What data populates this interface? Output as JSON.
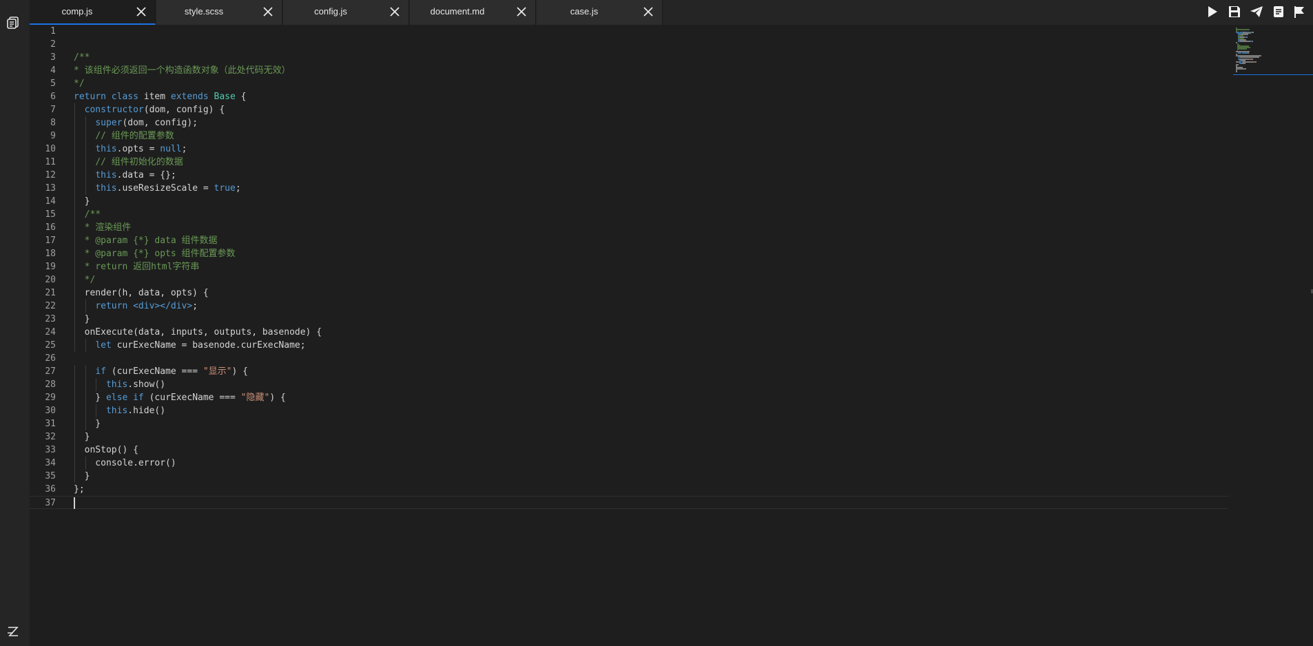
{
  "tabs": [
    {
      "label": "comp.js",
      "active": true
    },
    {
      "label": "style.scss",
      "active": false
    },
    {
      "label": "config.js",
      "active": false
    },
    {
      "label": "document.md",
      "active": false
    },
    {
      "label": "case.js",
      "active": false
    }
  ],
  "toolbar": [
    "run-icon",
    "save-icon",
    "send-icon",
    "document-icon",
    "flag-icon"
  ],
  "activity": {
    "top_icon": "files-icon",
    "bottom_icon": "logo-icon"
  },
  "colors": {
    "accent": "#1a73e8",
    "keyword": "#569cd6",
    "comment": "#6a9955",
    "string": "#ce9178",
    "class": "#4ec9b0"
  },
  "editor": {
    "current_line": 37,
    "lines": [
      {
        "n": "1",
        "t": []
      },
      {
        "n": "2",
        "t": []
      },
      {
        "n": "3",
        "t": [
          [
            "/**",
            "cm"
          ]
        ]
      },
      {
        "n": "4",
        "t": [
          [
            "* 该组件必须返回一个构造函数对象（此处代码无效）",
            "cm"
          ]
        ]
      },
      {
        "n": "5",
        "t": [
          [
            "*/",
            "cm"
          ]
        ]
      },
      {
        "n": "6",
        "t": [
          [
            "return",
            "kw"
          ],
          [
            " "
          ],
          [
            "class",
            "kw"
          ],
          [
            " item "
          ],
          [
            "extends",
            "kw"
          ],
          [
            " "
          ],
          [
            "Base",
            "cls"
          ],
          [
            " {"
          ]
        ]
      },
      {
        "n": "7",
        "t": [
          [
            "  "
          ],
          [
            "constructor",
            "kw"
          ],
          [
            "(dom, config) {"
          ]
        ]
      },
      {
        "n": "8",
        "t": [
          [
            "    "
          ],
          [
            "super",
            "kw"
          ],
          [
            "(dom, config);"
          ]
        ]
      },
      {
        "n": "9",
        "t": [
          [
            "    "
          ],
          [
            "// 组件的配置参数",
            "cm"
          ]
        ]
      },
      {
        "n": "10",
        "t": [
          [
            "    "
          ],
          [
            "this",
            "kw"
          ],
          [
            ".opts = "
          ],
          [
            "null",
            "kw"
          ],
          [
            ";"
          ]
        ]
      },
      {
        "n": "11",
        "t": [
          [
            "    "
          ],
          [
            "// 组件初始化的数据",
            "cm"
          ]
        ]
      },
      {
        "n": "12",
        "t": [
          [
            "    "
          ],
          [
            "this",
            "kw"
          ],
          [
            ".data = {};"
          ]
        ]
      },
      {
        "n": "13",
        "t": [
          [
            "    "
          ],
          [
            "this",
            "kw"
          ],
          [
            ".useResizeScale = "
          ],
          [
            "true",
            "kw"
          ],
          [
            ";"
          ]
        ]
      },
      {
        "n": "14",
        "t": [
          [
            "  }"
          ]
        ]
      },
      {
        "n": "15",
        "t": [
          [
            "  "
          ],
          [
            "/**",
            "cm"
          ]
        ]
      },
      {
        "n": "16",
        "t": [
          [
            "  "
          ],
          [
            "* 渲染组件",
            "cm"
          ]
        ]
      },
      {
        "n": "17",
        "t": [
          [
            "  "
          ],
          [
            "* @param {*} data 组件数据",
            "cm"
          ]
        ]
      },
      {
        "n": "18",
        "t": [
          [
            "  "
          ],
          [
            "* @param {*} opts 组件配置参数",
            "cm"
          ]
        ]
      },
      {
        "n": "19",
        "t": [
          [
            "  "
          ],
          [
            "* return 返回html字符串",
            "cm"
          ]
        ]
      },
      {
        "n": "20",
        "t": [
          [
            "  "
          ],
          [
            "*/",
            "cm"
          ]
        ]
      },
      {
        "n": "21",
        "t": [
          [
            "  render(h, data, opts) {"
          ]
        ]
      },
      {
        "n": "22",
        "t": [
          [
            "    "
          ],
          [
            "return",
            "kw"
          ],
          [
            " "
          ],
          [
            "<div></div>",
            "tag"
          ],
          [
            ";"
          ]
        ]
      },
      {
        "n": "23",
        "t": [
          [
            "  }"
          ]
        ]
      },
      {
        "n": "24",
        "t": [
          [
            "  onExecute(data, inputs, outputs, basenode) {"
          ]
        ]
      },
      {
        "n": "25",
        "t": [
          [
            "    "
          ],
          [
            "let",
            "kw"
          ],
          [
            " curExecName = basenode.curExecName;"
          ]
        ]
      },
      {
        "n": "26",
        "t": []
      },
      {
        "n": "27",
        "t": [
          [
            "    "
          ],
          [
            "if",
            "kw"
          ],
          [
            " (curExecName === "
          ],
          [
            "\"显示\"",
            "st"
          ],
          [
            ") {"
          ]
        ]
      },
      {
        "n": "28",
        "t": [
          [
            "      "
          ],
          [
            "this",
            "kw"
          ],
          [
            ".show()"
          ]
        ]
      },
      {
        "n": "29",
        "t": [
          [
            "    } "
          ],
          [
            "else",
            "kw"
          ],
          [
            " "
          ],
          [
            "if",
            "kw"
          ],
          [
            " (curExecName === "
          ],
          [
            "\"隐藏\"",
            "st"
          ],
          [
            ") {"
          ]
        ]
      },
      {
        "n": "30",
        "t": [
          [
            "      "
          ],
          [
            "this",
            "kw"
          ],
          [
            ".hide()"
          ]
        ]
      },
      {
        "n": "31",
        "t": [
          [
            "    }"
          ]
        ]
      },
      {
        "n": "32",
        "t": [
          [
            "  }"
          ]
        ]
      },
      {
        "n": "33",
        "t": [
          [
            "  onStop() {"
          ]
        ]
      },
      {
        "n": "34",
        "t": [
          [
            "    console.error()"
          ]
        ]
      },
      {
        "n": "35",
        "t": [
          [
            "  }"
          ]
        ]
      },
      {
        "n": "36",
        "t": [
          [
            "};"
          ]
        ]
      },
      {
        "n": "37",
        "t": []
      }
    ]
  }
}
